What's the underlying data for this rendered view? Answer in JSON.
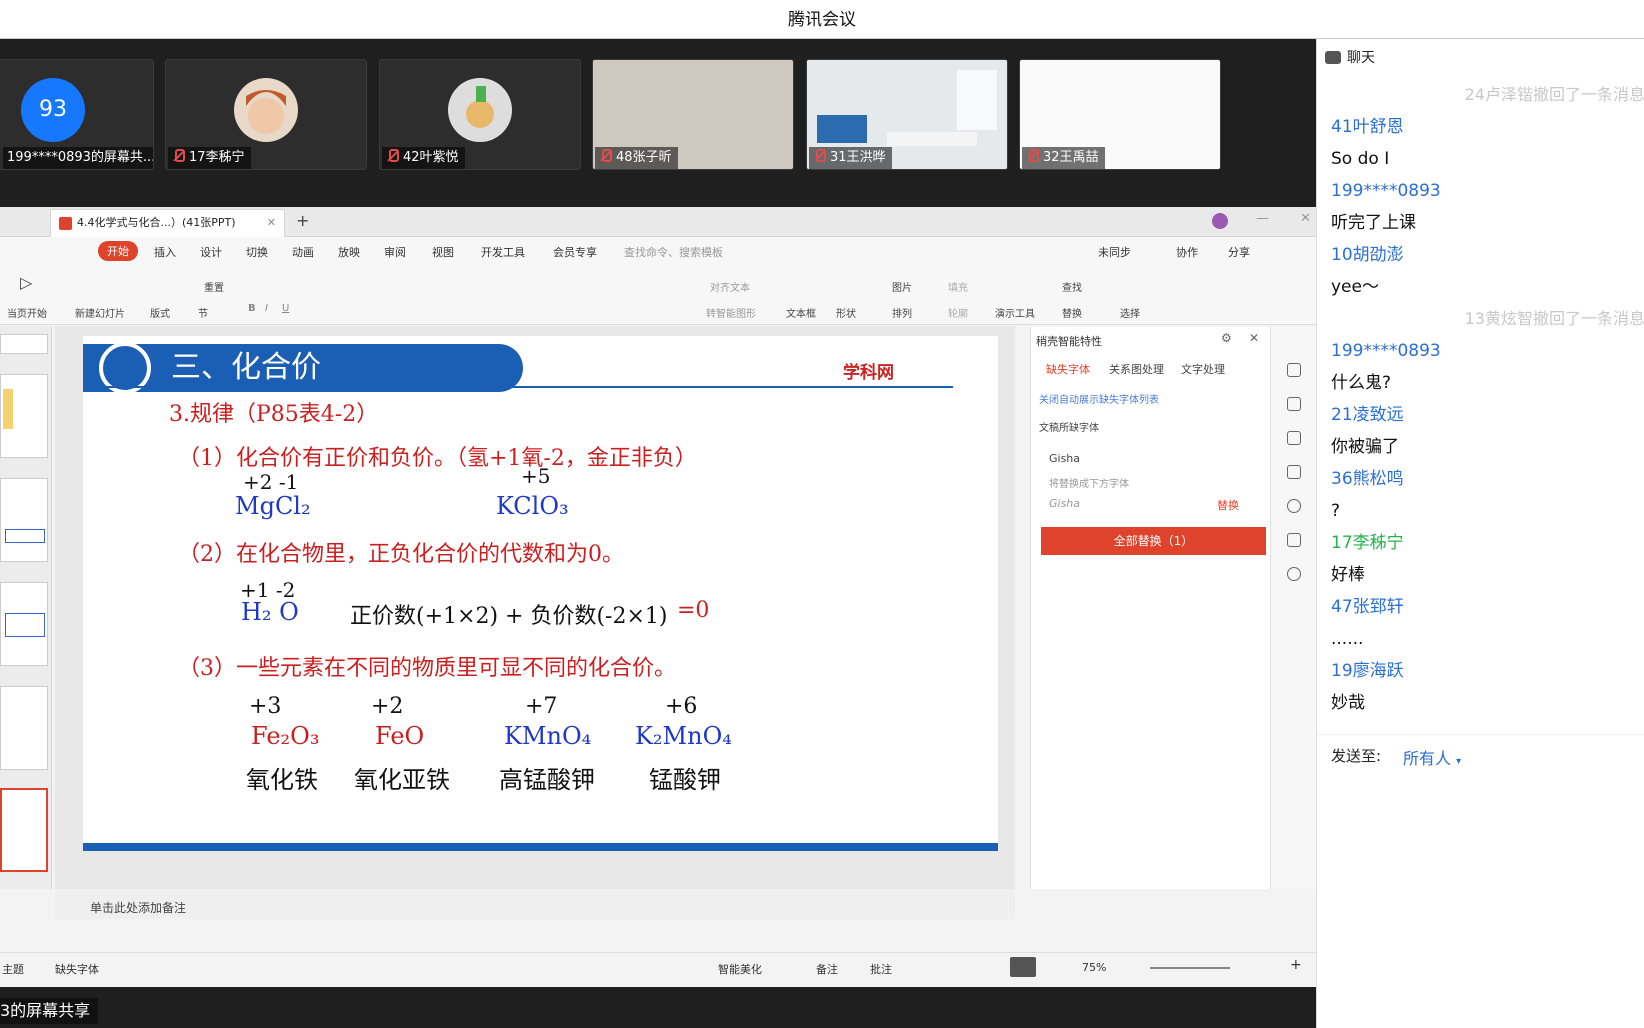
{
  "window_title": "腾讯会议",
  "participants": [
    {
      "label": "199****0893的屏幕共...",
      "avatar_text": "93"
    },
    {
      "label": "17李秭宁"
    },
    {
      "label": "42叶紫悦"
    },
    {
      "label": "48张子昕"
    },
    {
      "label": "31王洪晔"
    },
    {
      "label": "32王禹喆"
    }
  ],
  "ppt": {
    "tab_title": "4.4化学式与化合...）(41张PPT)",
    "menu": [
      "开始",
      "插入",
      "设计",
      "切换",
      "动画",
      "放映",
      "审阅",
      "视图",
      "开发工具",
      "会员专享"
    ],
    "search_placeholder": "查找命令、搜索模板",
    "sync": "未同步",
    "collab": "协作",
    "share": "分享",
    "toolbar": {
      "from_current": "当页开始",
      "new_slide": "新建幻灯片",
      "layout": "版式",
      "section": "节",
      "reset": "重置",
      "textbox": "文本框",
      "shape": "形状",
      "picture": "图片",
      "arrange": "排列",
      "fill": "填充",
      "outline": "轮廓",
      "present_tools": "演示工具",
      "find": "查找",
      "replace": "替换",
      "select": "选择",
      "align_text": "对齐文本",
      "smartart": "转智能图形"
    },
    "slide": {
      "heading": "三、化合价",
      "logo": "学科网",
      "rule": "3.规律（P85表4-2）",
      "p1": "（1）化合价有正价和负价。（氢+1氧-2，金正非负）",
      "p1_val_a": "+2  -1",
      "p1_formula_a": "MgCl₂",
      "p1_val_b": "+5",
      "p1_formula_b": "KClO₃",
      "p2": "（2）在化合物里，正负化合价的代数和为0。",
      "p2_val": "+1  -2",
      "p2_formula": "H₂  O",
      "p2_calc": "正价数(+1×2) + 负价数(-2×1)",
      "p2_eq": "=0",
      "p3": "（3）一些元素在不同的物质里可显不同的化合价。",
      "compounds": [
        {
          "val": "+3",
          "formula": "Fe₂O₃",
          "name": "氧化铁"
        },
        {
          "val": "+2",
          "formula": "FeO",
          "name": "氧化亚铁"
        },
        {
          "val": "+7",
          "formula": "KMnO₄",
          "name": "高锰酸钾"
        },
        {
          "val": "+6",
          "formula": "K₂MnO₄",
          "name": "锰酸钾"
        }
      ]
    },
    "notes_placeholder": "单击此处添加备注",
    "pane": {
      "title": "稍壳智能特性",
      "tabs": [
        "缺失字体",
        "关系图处理",
        "文字处理"
      ],
      "link": "关闭自动展示缺失字体列表",
      "section": "文稿所缺字体",
      "font_name": "Gisha",
      "font_hint": "将替换成下方字体",
      "font_preview": "Gisha",
      "font_action": "替换",
      "replace_all": "全部替换（1）"
    },
    "status": {
      "theme": "主题",
      "missing_font": "缺失字体",
      "beautify": "智能美化",
      "notes": "备注",
      "comments": "批注",
      "zoom": "75%"
    }
  },
  "share_caption": "3的屏幕共享",
  "chat": {
    "title": "聊天",
    "messages": [
      {
        "type": "sys",
        "text": "24卢泽锴撤回了一条消息"
      },
      {
        "type": "name",
        "text": "41叶舒恩"
      },
      {
        "type": "msg",
        "text": "So do I"
      },
      {
        "type": "name",
        "text": "199****0893"
      },
      {
        "type": "msg",
        "text": "听完了上课"
      },
      {
        "type": "name",
        "text": "10胡劭澎"
      },
      {
        "type": "msg",
        "text": "yee～"
      },
      {
        "type": "sys",
        "text": "13黄炫智撤回了一条消息"
      },
      {
        "type": "name",
        "text": "199****0893"
      },
      {
        "type": "msg",
        "text": "什么鬼?"
      },
      {
        "type": "name",
        "text": "21凌致远"
      },
      {
        "type": "msg",
        "text": "你被骗了"
      },
      {
        "type": "name",
        "text": "36熊松鸣"
      },
      {
        "type": "msg",
        "text": "?"
      },
      {
        "type": "green",
        "text": "17李秭宁"
      },
      {
        "type": "msg",
        "text": "好棒"
      },
      {
        "type": "name",
        "text": "47张郅轩"
      },
      {
        "type": "msg",
        "text": "......"
      },
      {
        "type": "name",
        "text": "19廖海跃"
      },
      {
        "type": "msg",
        "text": "妙哉"
      }
    ],
    "send_to_label": "发送至:",
    "send_to_value": "所有人"
  }
}
